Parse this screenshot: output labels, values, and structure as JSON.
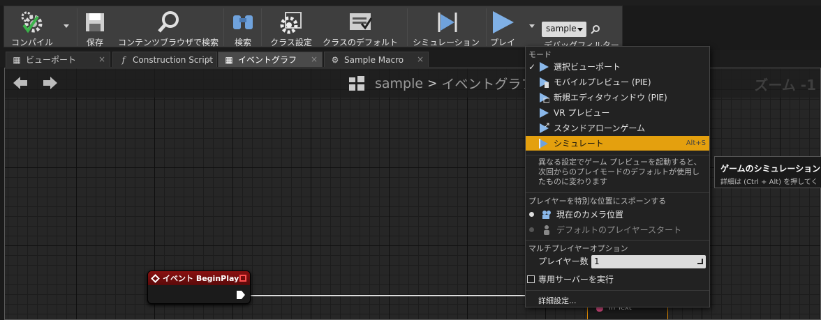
{
  "toolbar": {
    "compile": "コンパイル",
    "save": "保存",
    "content_browser": "コンテンツブラウザで検索",
    "search": "検索",
    "class_settings": "クラス設定",
    "class_defaults": "クラスのデフォルト",
    "simulation": "シミュレーション",
    "play": "プレイ",
    "debug_object": "sample",
    "debug_filter": "デバッグフィルター"
  },
  "tabs": [
    {
      "label": "ビューポート",
      "icon": "grid-icon"
    },
    {
      "label": "Construction Script",
      "icon": "function-icon"
    },
    {
      "label": "イベントグラフ",
      "icon": "graph-icon",
      "active": true
    },
    {
      "label": "Sample Macro",
      "icon": "gear-icon"
    }
  ],
  "graph": {
    "breadcrumb_root": "sample",
    "breadcrumb_sep": ">",
    "breadcrumb_current": "イベントグラフ",
    "zoom": "ズーム -1",
    "node_title": "イベント BeginPlay",
    "node2_pin": "In Text"
  },
  "menu": {
    "mode_header": "モード",
    "items": [
      {
        "label": "選択ビューポート",
        "checked": true
      },
      {
        "label": "モバイルプレビュー (PIE)"
      },
      {
        "label": "新規エディタウィンドウ (PIE)"
      },
      {
        "label": "VR プレビュー"
      },
      {
        "label": "スタンドアローンゲーム"
      },
      {
        "label": "シミュレート",
        "shortcut": "Alt+S",
        "highlighted": true
      }
    ],
    "description": "異なる設定でゲーム プレビューを起動すると、次回からのプレイモードのデフォルトが使用したものに変わります",
    "spawn_header": "プレイヤーを特別な位置にスポーンする",
    "spawn_options": [
      {
        "label": "現在のカメラ位置",
        "selected": true
      },
      {
        "label": "デフォルトのプレイヤースタート",
        "selected": false
      }
    ],
    "multiplayer_header": "マルチプレイヤーオプション",
    "player_count_label": "プレイヤー数",
    "player_count": "1",
    "dedicated_server": "専用サーバーを実行",
    "advanced": "詳細設定..."
  },
  "tooltip": {
    "title": "ゲームのシミュレーション",
    "hint": "詳細は (Ctrl + Alt) を押してく"
  },
  "colors": {
    "highlight": "#e4a00e",
    "node_header": "#8a1010",
    "accent_blue": "#3e7fd0"
  }
}
